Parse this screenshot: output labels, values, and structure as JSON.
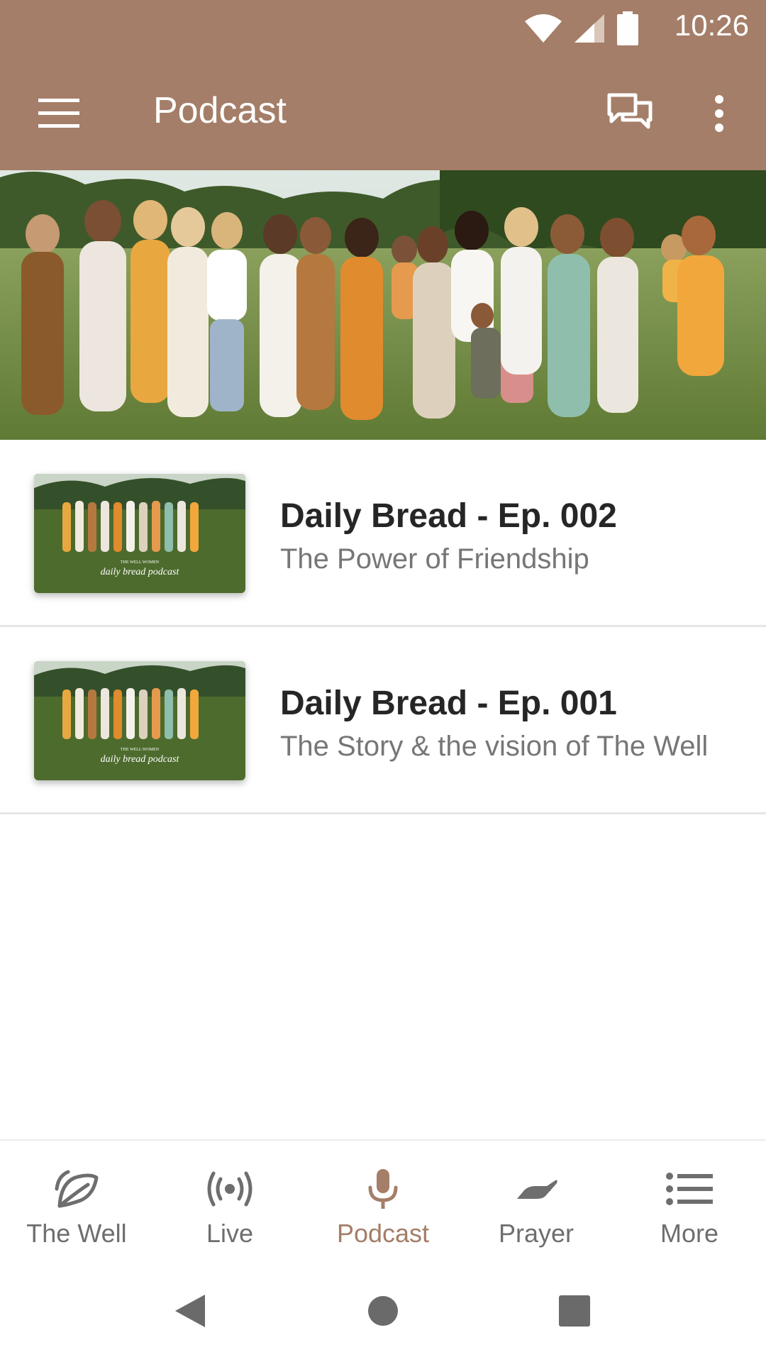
{
  "status_bar": {
    "time": "10:26"
  },
  "app_bar": {
    "title": "Podcast"
  },
  "episodes": [
    {
      "title": "Daily Bread - Ep. 002",
      "subtitle": "The Power of Friendship",
      "thumb_caption_top": "THE WELL WOMEN",
      "thumb_caption_main": "daily bread podcast"
    },
    {
      "title": "Daily Bread - Ep. 001",
      "subtitle": "The Story & the vision of The Well",
      "thumb_caption_top": "THE WELL WOMEN",
      "thumb_caption_main": "daily bread podcast"
    }
  ],
  "bottom_nav": [
    {
      "label": "The Well",
      "icon": "leaf-icon",
      "active": false
    },
    {
      "label": "Live",
      "icon": "broadcast-icon",
      "active": false
    },
    {
      "label": "Podcast",
      "icon": "microphone-icon",
      "active": true
    },
    {
      "label": "Prayer",
      "icon": "hand-icon",
      "active": false
    },
    {
      "label": "More",
      "icon": "list-icon",
      "active": false
    }
  ],
  "colors": {
    "brand": "#a47e68",
    "active_nav": "#a47e68",
    "inactive_nav": "#6e6e6e"
  }
}
